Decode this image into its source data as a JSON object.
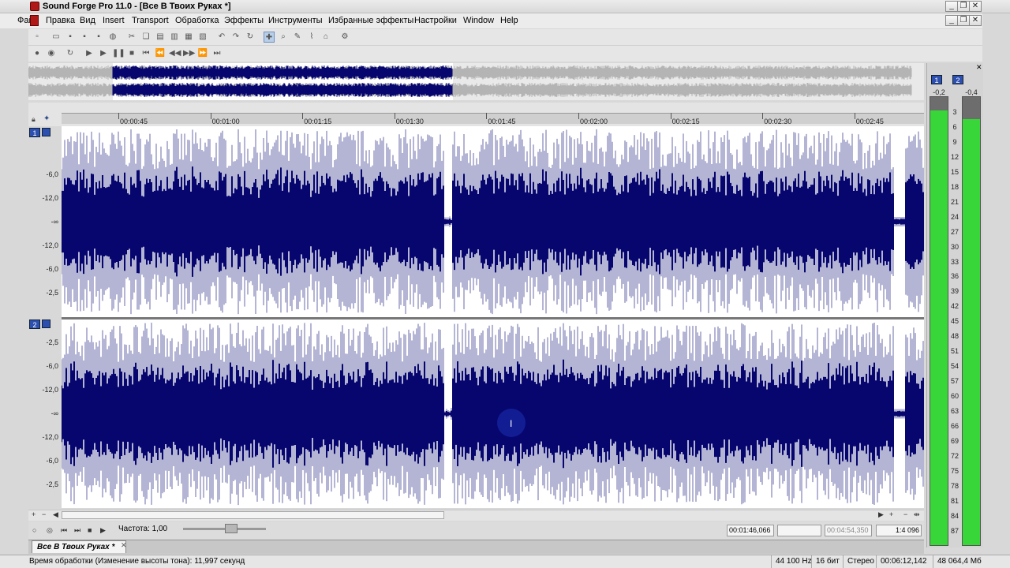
{
  "window": {
    "title": "Sound Forge Pro 11.0 - [Все В Твоих Руках *]"
  },
  "menu": [
    "Файл",
    "Правка",
    "Вид",
    "Insert",
    "Transport",
    "Обработка",
    "Эффекты",
    "Инструменты",
    "Избранные эффекты",
    "Настройки",
    "Window",
    "Help"
  ],
  "ruler": {
    "times": [
      "00:00:45",
      "00:01:00",
      "00:01:15",
      "00:01:30",
      "00:01:45",
      "00:02:00",
      "00:02:15",
      "00:02:30",
      "00:02:45"
    ]
  },
  "channel1": {
    "number": "1",
    "db_labels": [
      "-6,0",
      "-12,0",
      "-∞",
      "-12,0",
      "-6,0",
      "-2,5"
    ]
  },
  "channel2": {
    "number": "2",
    "db_labels": [
      "-2,5",
      "-6,0",
      "-12,0",
      "-∞",
      "-12,0",
      "-6,0",
      "-2,5"
    ]
  },
  "transport": {
    "rate_label": "Частота: 1,00",
    "position": "00:01:46,066",
    "length": "00:04:54,350",
    "zoom": "1:4 096"
  },
  "doc_tab": {
    "name": "Все В Твоих Руках *"
  },
  "status": {
    "processing": "Время обработки (Изменение высоты тона): 11,997 секунд",
    "sample_rate": "44 100 Hz",
    "bit_depth": "16 бит",
    "channels": "Стерео",
    "duration": "00:06:12,142",
    "free_space": "48 064,4 Мб"
  },
  "meters": {
    "ch1": "1",
    "ch2": "2",
    "peak1": "-0,2",
    "peak2": "-0,4",
    "scale": [
      "3",
      "6",
      "9",
      "12",
      "15",
      "18",
      "21",
      "24",
      "27",
      "30",
      "33",
      "36",
      "39",
      "42",
      "45",
      "48",
      "51",
      "54",
      "57",
      "60",
      "63",
      "66",
      "69",
      "72",
      "75",
      "78",
      "81",
      "84",
      "87"
    ],
    "level1": 0.97,
    "level2": 0.95
  },
  "colors": {
    "waveform": "#06066e",
    "meter_green": "#39d639"
  }
}
